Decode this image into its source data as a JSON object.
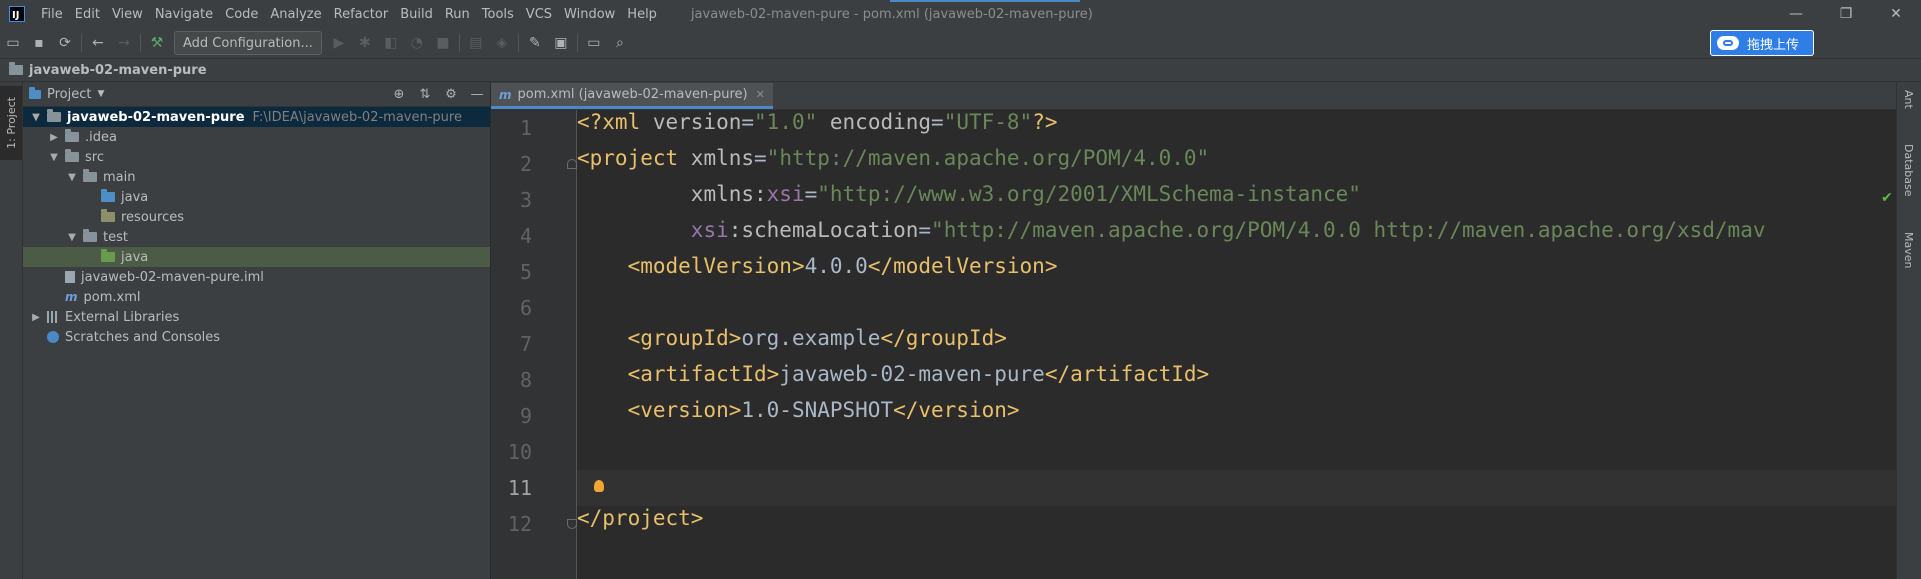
{
  "titlebar": {
    "logo_text": "IJ",
    "menu": [
      "File",
      "Edit",
      "View",
      "Navigate",
      "Code",
      "Analyze",
      "Refactor",
      "Build",
      "Run",
      "Tools",
      "VCS",
      "Window",
      "Help"
    ],
    "window_title": "javaweb-02-maven-pure - pom.xml (javaweb-02-maven-pure)",
    "controls": [
      "—",
      "❐",
      "✕"
    ]
  },
  "toolbar": {
    "add_configuration_label": "Add Configuration...",
    "upload_label": "拖拽上传"
  },
  "navbar": {
    "breadcrumb": "javaweb-02-maven-pure"
  },
  "left_stripe": {
    "project_tab": "1: Project"
  },
  "project_panel": {
    "title": "Project",
    "tree": [
      {
        "label": "javaweb-02-maven-pure",
        "hint": "F:\\IDEA\\javaweb-02-maven-pure"
      },
      {
        "label": ".idea"
      },
      {
        "label": "src"
      },
      {
        "label": "main"
      },
      {
        "label": "java"
      },
      {
        "label": "resources"
      },
      {
        "label": "test"
      },
      {
        "label": "java"
      },
      {
        "label": "javaweb-02-maven-pure.iml"
      },
      {
        "label": "pom.xml"
      },
      {
        "label": "External Libraries"
      },
      {
        "label": "Scratches and Consoles"
      }
    ]
  },
  "editor": {
    "tab_label": "pom.xml (javaweb-02-maven-pure)",
    "line_numbers": [
      "1",
      "2",
      "3",
      "4",
      "5",
      "6",
      "7",
      "8",
      "9",
      "10",
      "11",
      "12"
    ],
    "code": {
      "l1_open": "<?xml ",
      "l1_attr1": "version",
      "l1_eq1": "=",
      "l1_val1": "\"1.0\"",
      "l1_attr2": " encoding",
      "l1_eq2": "=",
      "l1_val2": "\"UTF-8\"",
      "l1_close": "?>",
      "l2_open": "<project ",
      "l2_attr": "xmlns",
      "l2_eq": "=",
      "l2_val": "\"http://maven.apache.org/POM/4.0.0\"",
      "l3_indent": "         ",
      "l3_attr": "xmlns:",
      "l3_ns": "xsi",
      "l3_eq": "=",
      "l3_val": "\"http://www.w3.org/2001/XMLSchema-instance\"",
      "l4_indent": "         ",
      "l4_ns": "xsi",
      "l4_attr": ":schemaLocation",
      "l4_eq": "=",
      "l4_val": "\"http://maven.apache.org/POM/4.0.0 http://maven.apache.org/xsd/mav",
      "l5_indent": "    ",
      "l5_open": "<modelVersion>",
      "l5_text": "4.0.0",
      "l5_close": "</modelVersion>",
      "l7_indent": "    ",
      "l7_open": "<groupId>",
      "l7_text": "org.example",
      "l7_close": "</groupId>",
      "l8_indent": "    ",
      "l8_open": "<artifactId>",
      "l8_text": "javaweb-02-maven-pure",
      "l8_close": "</artifactId>",
      "l9_indent": "    ",
      "l9_open": "<version>",
      "l9_text": "1.0-SNAPSHOT",
      "l9_close": "</version>",
      "l12_close": "</project>"
    }
  },
  "right_stripe": {
    "tabs": [
      "Ant",
      "Database",
      "Maven"
    ]
  },
  "colors": {
    "background": "#2b2b2b",
    "panel": "#3c3f41",
    "tag": "#e8bf6a",
    "string": "#6a8759",
    "namespace": "#9876aa",
    "accent": "#4a88c7"
  }
}
